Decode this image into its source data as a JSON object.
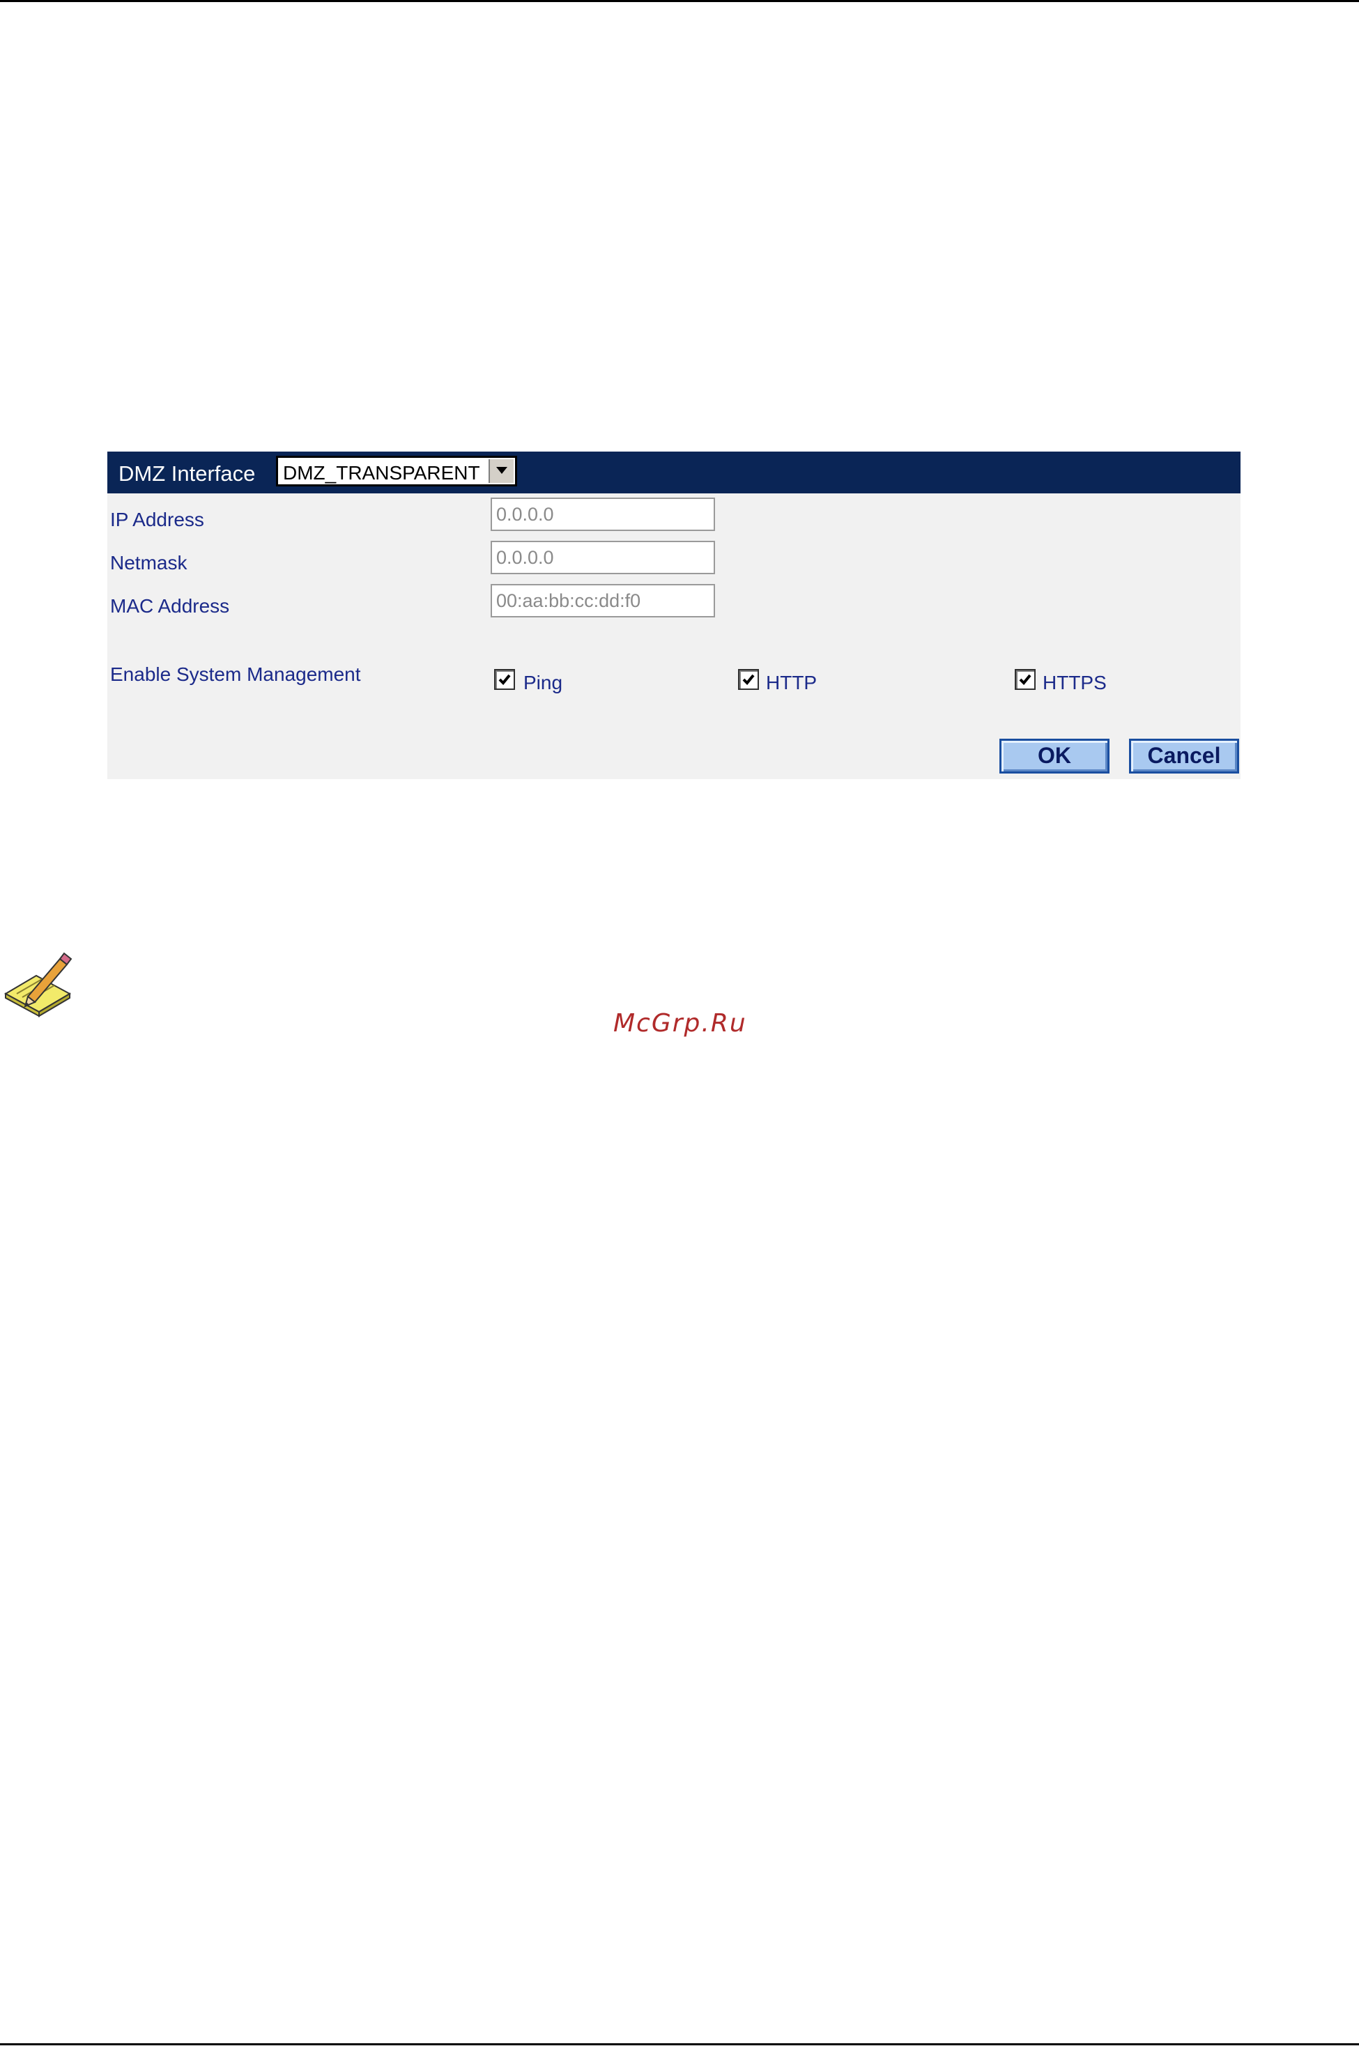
{
  "header": {
    "label": "DMZ Interface",
    "interface_select": {
      "value": "DMZ_TRANSPARENT"
    }
  },
  "fields": [
    {
      "label": "IP Address",
      "value": "0.0.0.0"
    },
    {
      "label": "Netmask",
      "value": "0.0.0.0"
    },
    {
      "label": "MAC Address",
      "value": "00:aa:bb:cc:dd:f0"
    }
  ],
  "management": {
    "label": "Enable System Management",
    "options": [
      {
        "label": "Ping",
        "checked": true
      },
      {
        "label": "HTTP",
        "checked": true
      },
      {
        "label": "HTTPS",
        "checked": true
      }
    ]
  },
  "buttons": {
    "ok": "OK",
    "cancel": "Cancel"
  },
  "note_icon": "pencil-notepad-icon",
  "watermark": "McGrp.Ru",
  "colors": {
    "header_bar": "#0a2556",
    "label_text": "#1b2a8a",
    "button_fill": "#a9c9f0",
    "watermark": "#b02a2a"
  }
}
